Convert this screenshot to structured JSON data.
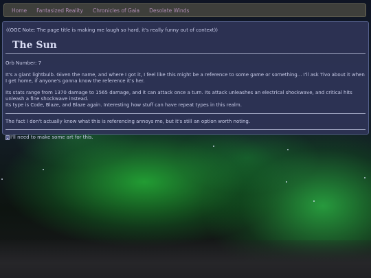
{
  "nav": {
    "items": [
      {
        "label": "Home"
      },
      {
        "label": "Fantasized Reality"
      },
      {
        "label": "Chronicles of Gaia"
      },
      {
        "label": "Desolate Winds"
      }
    ]
  },
  "content": {
    "ooc_note": "((OOC Note: The page title is making me laugh so hard, it's really funny out of context))",
    "title": "The Sun",
    "orb_number": "Orb Number: 7",
    "paragraph_1": "It's a giant lightbulb. Given the name, and where I got it, I feel like this might be a reference to some game or something... I'll ask Tivo about it when I get home, if anyone's gonna know the reference it's her.",
    "paragraph_2": "Its stats range from 1370 damage to 1565 damage, and it can attack once a turn. Its attack unleashes an electrical shockwave, and critical hits unleash a fine shockwave instead.",
    "paragraph_3": "Its type is Code, Blaze, and Blaze again. Interesting how stuff can have repeat types in this realm.",
    "paragraph_4": "The fact I don't actually know what this is referencing annoys me, but it's still an option worth noting.",
    "image_alt": "I'll need to make some art for this."
  },
  "colors": {
    "nav_link": "#b08db5",
    "panel_bg": "#2e3456",
    "text": "#c9cce8",
    "aurora": "#2fc84a"
  },
  "icons": {
    "broken_image": "broken-image-icon"
  }
}
